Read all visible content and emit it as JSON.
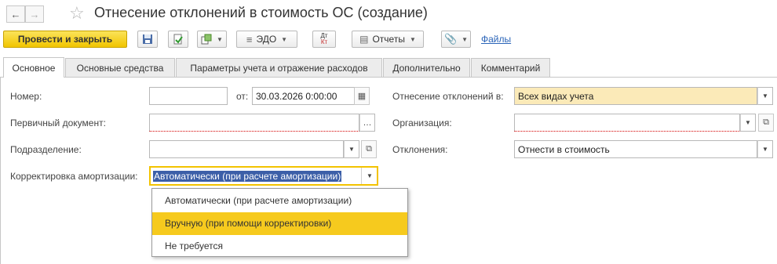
{
  "window": {
    "title": "Отнесение отклонений в стоимость ОС (создание)"
  },
  "toolbar": {
    "post_close_label": "Провести и закрыть",
    "edo_label": "ЭДО",
    "dt_kt_top": "Дт",
    "dt_kt_bottom": "Кт",
    "reports_label": "Отчеты",
    "files_link": "Файлы"
  },
  "tabs": [
    {
      "label": "Основное",
      "active": true
    },
    {
      "label": "Основные средства",
      "active": false
    },
    {
      "label": "Параметры учета и отражение расходов",
      "active": false
    },
    {
      "label": "Дополнительно",
      "active": false
    },
    {
      "label": "Комментарий",
      "active": false
    }
  ],
  "form": {
    "number_label": "Номер:",
    "number_value": "",
    "from_label": "от:",
    "date_value": "30.03.2026  0:00:00",
    "primary_doc_label": "Первичный документ:",
    "primary_doc_value": "",
    "dept_label": "Подразделение:",
    "dept_value": "",
    "depr_label": "Корректировка амортизации:",
    "depr_value": "Автоматически (при расчете амортизации)",
    "deviation_in_label": "Отнесение отклонений в:",
    "deviation_in_value": "Всех видах учета",
    "org_label": "Организация:",
    "org_value": "",
    "deviations_label": "Отклонения:",
    "deviations_value": "Отнести в стоимость"
  },
  "dropdown": {
    "options": [
      "Автоматически (при расчете амортизации)",
      "Вручную (при помощи корректировки)",
      "Не требуется"
    ],
    "highlighted_index": 1
  },
  "colors": {
    "primary_button": "#f1c500",
    "highlight": "#f6ca1e",
    "link": "#2a64b8"
  }
}
